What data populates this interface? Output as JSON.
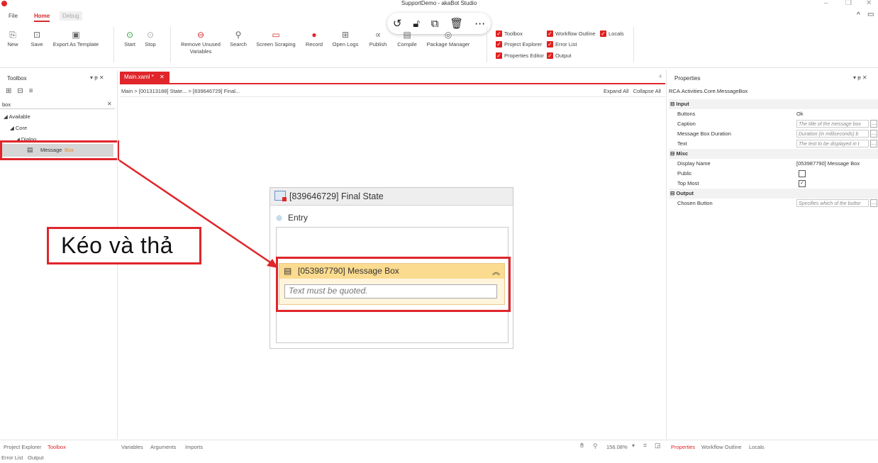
{
  "app": {
    "title": "SupportDemo - akaBot Studio"
  },
  "menu": {
    "file": "File",
    "home": "Home",
    "debug": "Debug"
  },
  "ribbon": {
    "new": "New",
    "save": "Save",
    "export_template": "Export As Template",
    "start": "Start",
    "stop": "Stop",
    "remove_unused_1": "Remove Unused",
    "remove_unused_2": "Variables",
    "search": "Search",
    "screen_scraping": "Screen Scraping",
    "record": "Record",
    "open_logs": "Open Logs",
    "publish": "Publish",
    "compile": "Compile",
    "package_manager": "Package Manager",
    "checks": {
      "toolbox": "Toolbox",
      "workflow_outline": "Workflow Outline",
      "locals": "Locals",
      "project_explorer": "Project Explorer",
      "error_list": "Error List",
      "properties_editor": "Properties Editor",
      "output": "Output"
    }
  },
  "toolbox": {
    "title": "Toolbox",
    "search_value": "box",
    "tree": {
      "available": "Available",
      "core": "Core",
      "dialog": "Dialog",
      "item_main": "Message",
      "item_highlight": "Box"
    }
  },
  "document": {
    "tab": "Main.xaml *",
    "breadcrumb": "Main  >  [001313188] State...  >  [839646729] Final...",
    "expand_all": "Expand All",
    "collapse_all": "Collapse All"
  },
  "designer": {
    "state_title": "[839646729] Final State",
    "entry": "Entry",
    "activity_title": "[053987790] Message Box",
    "activity_input_placeholder": "Text must be quoted.",
    "annotation": "Kéo và thả"
  },
  "properties": {
    "title": "Properties",
    "type": "RCA.Activities.Core.MessageBox",
    "cat_input": "Input",
    "buttons_label": "Buttons",
    "buttons_value": "Ok",
    "caption_label": "Caption",
    "caption_ph": "The title of the message box",
    "duration_label": "Message Box Duration",
    "duration_ph": "Duration (in milliseconds) b",
    "text_label": "Text",
    "text_ph": "The text to be displayed in t",
    "cat_misc": "Misc",
    "display_label": "Display Name",
    "display_value": "[053987790] Message Box",
    "public_label": "Public",
    "topmost_label": "Top Most",
    "cat_output": "Output",
    "chosen_label": "Chosen Button",
    "chosen_ph": "Specifies which of the buttor"
  },
  "bottom": {
    "project_explorer": "Project Explorer",
    "toolbox": "Toolbox",
    "error_list": "Error List",
    "output": "Output",
    "variables": "Variables",
    "arguments": "Arguments",
    "imports": "Imports",
    "zoom": "156.08%",
    "properties": "Properties",
    "workflow_outline": "Workflow Outline",
    "locals": "Locals"
  }
}
